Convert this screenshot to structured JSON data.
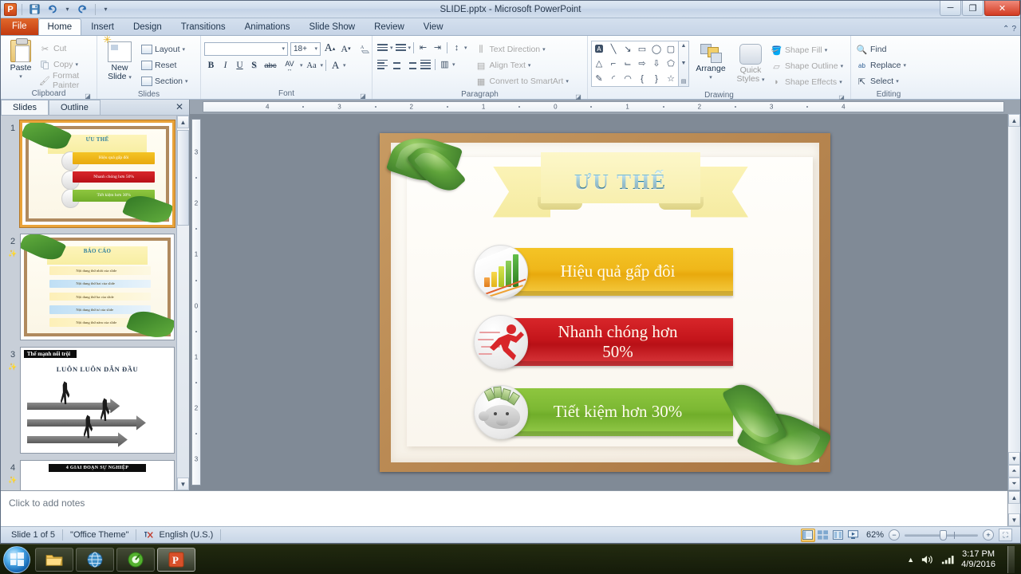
{
  "window": {
    "title": "SLIDE.pptx - Microsoft PowerPoint",
    "app_icon": "P",
    "quick_access": [
      {
        "name": "save-icon",
        "glyph": "💾"
      },
      {
        "name": "undo-icon",
        "glyph": "↶"
      },
      {
        "name": "redo-icon",
        "glyph": "↷"
      },
      {
        "name": "customize-qat-icon",
        "glyph": "▼"
      }
    ],
    "controls": {
      "minimize": "─",
      "maximize": "❐",
      "close": "✕"
    },
    "help_icon": "?",
    "ribbon_minimize_icon": "⌃"
  },
  "tabs": [
    {
      "label": "File",
      "active": false,
      "kind": "file"
    },
    {
      "label": "Home",
      "active": true
    },
    {
      "label": "Insert",
      "active": false
    },
    {
      "label": "Design",
      "active": false
    },
    {
      "label": "Transitions",
      "active": false
    },
    {
      "label": "Animations",
      "active": false
    },
    {
      "label": "Slide Show",
      "active": false
    },
    {
      "label": "Review",
      "active": false
    },
    {
      "label": "View",
      "active": false
    }
  ],
  "ribbon": {
    "clipboard": {
      "label": "Clipboard",
      "paste": "Paste",
      "cut": "Cut",
      "copy": "Copy",
      "format_painter": "Format Painter"
    },
    "slides": {
      "label": "Slides",
      "new_slide": "New\nSlide",
      "new_slide_line1": "New",
      "new_slide_line2": "Slide",
      "layout": "Layout",
      "reset": "Reset",
      "section": "Section"
    },
    "font": {
      "label": "Font",
      "font_name": "",
      "font_size": "18+",
      "grow": "A",
      "shrink": "A",
      "clear_formatting": "A̶",
      "bold": "B",
      "italic": "I",
      "underline": "U",
      "shadow": "S",
      "strikethrough": "abc",
      "char_spacing": "AV",
      "change_case": "Aa",
      "font_color": "A"
    },
    "paragraph": {
      "label": "Paragraph",
      "text_direction": "Text Direction",
      "align_text": "Align Text",
      "convert_to_smartart": "Convert to SmartArt"
    },
    "drawing": {
      "label": "Drawing",
      "arrange": "Arrange",
      "quick_styles_line1": "Quick",
      "quick_styles_line2": "Styles",
      "shape_fill": "Shape Fill",
      "shape_outline": "Shape Outline",
      "shape_effects": "Shape Effects"
    },
    "editing": {
      "label": "Editing",
      "find": "Find",
      "replace": "Replace",
      "select": "Select"
    }
  },
  "thumb_pane": {
    "tabs": [
      {
        "label": "Slides",
        "active": true
      },
      {
        "label": "Outline",
        "active": false
      }
    ],
    "close_icon": "✕",
    "slides": [
      {
        "number": "1",
        "title": "ƯU THẾ",
        "bars": [
          {
            "text": "Hiệu quả gấp đôi",
            "color": "#efb71a"
          },
          {
            "text": "Nhanh chóng hơn 50%",
            "color": "#c4151b"
          },
          {
            "text": "Tiết kiệm hơn 30%",
            "color": "#7cb833"
          }
        ]
      },
      {
        "number": "2",
        "title": "BÁO CÁO",
        "rows": [
          "Nội dung thứ nhất của slide",
          "Nội dung thứ hai của slide",
          "Nội dung thứ ba của slide",
          "Nội dung thứ tư của slide",
          "Nội dung thứ năm của slide"
        ]
      },
      {
        "number": "3",
        "tag": "Thế mạnh nổi trội",
        "headline": "LUÔN LUÔN DẪN ĐẦU"
      },
      {
        "number": "4",
        "tag": "4 GIAI ĐOẠN SỰ NGHIỆP"
      }
    ]
  },
  "rulers": {
    "horizontal": [
      "4",
      "3",
      "2",
      "1",
      "0",
      "1",
      "2",
      "3",
      "4"
    ],
    "vertical": [
      "3",
      "2",
      "1",
      "0",
      "1",
      "2",
      "3"
    ]
  },
  "slide": {
    "title": "ƯU THẾ",
    "items": [
      {
        "text": "Hiệu quả gấp đôi",
        "color": "#efb71a",
        "icon": "bar-chart-icon"
      },
      {
        "text_line1": "Nhanh chóng hơn",
        "text_line2": "50%",
        "color": "#c4151b",
        "icon": "running-man-icon"
      },
      {
        "text": "Tiết kiệm hơn 30%",
        "color": "#7cb833",
        "icon": "piggy-bank-icon"
      }
    ]
  },
  "notes": {
    "placeholder": "Click to add notes"
  },
  "status_bar": {
    "slide_counter": "Slide 1 of 5",
    "theme": "\"Office Theme\"",
    "language": "English (U.S.)",
    "spell_icon": "spell-check-icon",
    "views": [
      {
        "name": "normal-view-button",
        "label": "Normal",
        "active": true
      },
      {
        "name": "slide-sorter-view-button",
        "label": "Slide Sorter",
        "active": false
      },
      {
        "name": "reading-view-button",
        "label": "Reading View",
        "active": false
      },
      {
        "name": "slide-show-button",
        "label": "Slide Show",
        "active": false
      }
    ],
    "zoom_level": "62%",
    "zoom_out": "−",
    "zoom_in": "+",
    "fit_to_window": "fit-slide-to-window-icon"
  },
  "taskbar": {
    "start": "start-orb",
    "items": [
      {
        "name": "taskbar-explorer",
        "icon": "folder-icon"
      },
      {
        "name": "taskbar-browser",
        "icon": "globe-icon"
      },
      {
        "name": "taskbar-app",
        "icon": "green-app-icon"
      },
      {
        "name": "taskbar-powerpoint",
        "icon": "powerpoint-icon",
        "active": true
      }
    ],
    "tray": {
      "show_hidden": "▲",
      "volume": "volume-icon",
      "network": "network-icon",
      "time": "3:17 PM",
      "date": "4/9/2016"
    }
  },
  "colors": {
    "file_tab": "#c23a10",
    "gold": "#efb71a",
    "red": "#c4151b",
    "green": "#7cb833",
    "title_teal": "#1f7fa0",
    "frame_brown": "#a87440"
  }
}
